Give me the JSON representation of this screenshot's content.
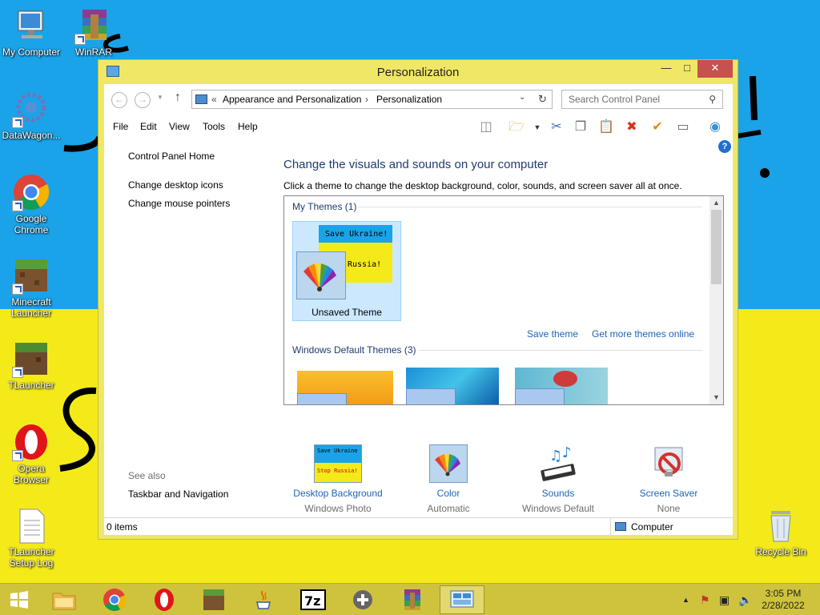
{
  "desktop": {
    "icons": [
      {
        "label": "My Computer"
      },
      {
        "label": "WinRAR"
      },
      {
        "label": "DataWagon..."
      },
      {
        "label": "Google Chrome"
      },
      {
        "label": "Minecraft Launcher"
      },
      {
        "label": "TLauncher"
      },
      {
        "label": "Opera Browser"
      },
      {
        "label": "TLauncher Setup Log"
      },
      {
        "label": "Recycle Bin"
      }
    ]
  },
  "window": {
    "title": "Personalization",
    "address": {
      "sep": "«",
      "crumbs": [
        "Appearance and Personalization",
        "Personalization"
      ]
    },
    "search_placeholder": "Search Control Panel",
    "menu": [
      "File",
      "Edit",
      "View",
      "Tools",
      "Help"
    ],
    "left_nav": {
      "home": "Control Panel Home",
      "links": [
        "Change desktop icons",
        "Change mouse pointers"
      ],
      "see_also_title": "See also",
      "see_also": [
        "Taskbar and Navigation"
      ]
    },
    "heading": "Change the visuals and sounds on your computer",
    "instruction": "Click a theme to change the desktop background, color, sounds, and screen saver all at once.",
    "my_themes": {
      "header": "My Themes (1)",
      "items": [
        {
          "name": "Unsaved Theme",
          "wall_line1": "Save Ukraine!",
          "wall_line2": "Russia!"
        }
      ],
      "save_theme": "Save theme",
      "get_more": "Get more themes online"
    },
    "default_themes": {
      "header": "Windows Default Themes (3)"
    },
    "bottom": [
      {
        "label": "Desktop Background",
        "sub": "Windows Photo Viewer Wallpaper",
        "thumb_line1": "Save Ukraine",
        "thumb_line2": "Stop Russia!"
      },
      {
        "label": "Color",
        "sub": "Automatic"
      },
      {
        "label": "Sounds",
        "sub": "Windows Default"
      },
      {
        "label": "Screen Saver",
        "sub": "None"
      }
    ],
    "status": {
      "items": "0 items",
      "location": "Computer"
    }
  },
  "taskbar": {
    "time": "3:05 PM",
    "date": "2/28/2022",
    "apps": [
      "file-explorer",
      "chrome",
      "opera",
      "minecraft",
      "java",
      "7zip",
      "gamepad",
      "winrar",
      "control-panel"
    ]
  },
  "colors": {
    "desktop_blue": "#1aa3e8",
    "desktop_yellow": "#f4ea1a",
    "window_frame": "#f1e766",
    "taskbar": "#cfc33d",
    "link_blue": "#1e63b6"
  }
}
